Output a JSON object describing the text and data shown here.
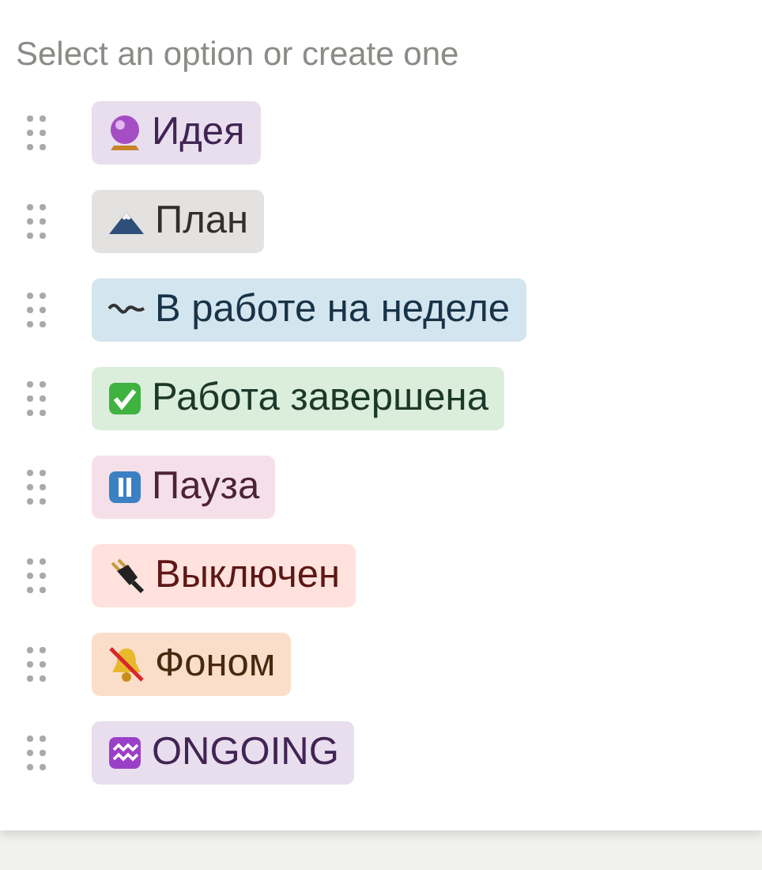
{
  "heading": "Select an option or create one",
  "options": [
    {
      "label": "Идея",
      "color": "#e8deee"
    },
    {
      "label": "План",
      "color": "#e3e2e0"
    },
    {
      "label": "В работе на неделе",
      "color": "#d3e5ef"
    },
    {
      "label": "Работа завершена",
      "color": "#dbeddb"
    },
    {
      "label": "Пауза",
      "color": "#f5e0e9"
    },
    {
      "label": "Выключен",
      "color": "#ffe2dd"
    },
    {
      "label": "Фоном",
      "color": "#fadec9"
    },
    {
      "label": "ONGOING",
      "color": "#e8deee"
    }
  ]
}
